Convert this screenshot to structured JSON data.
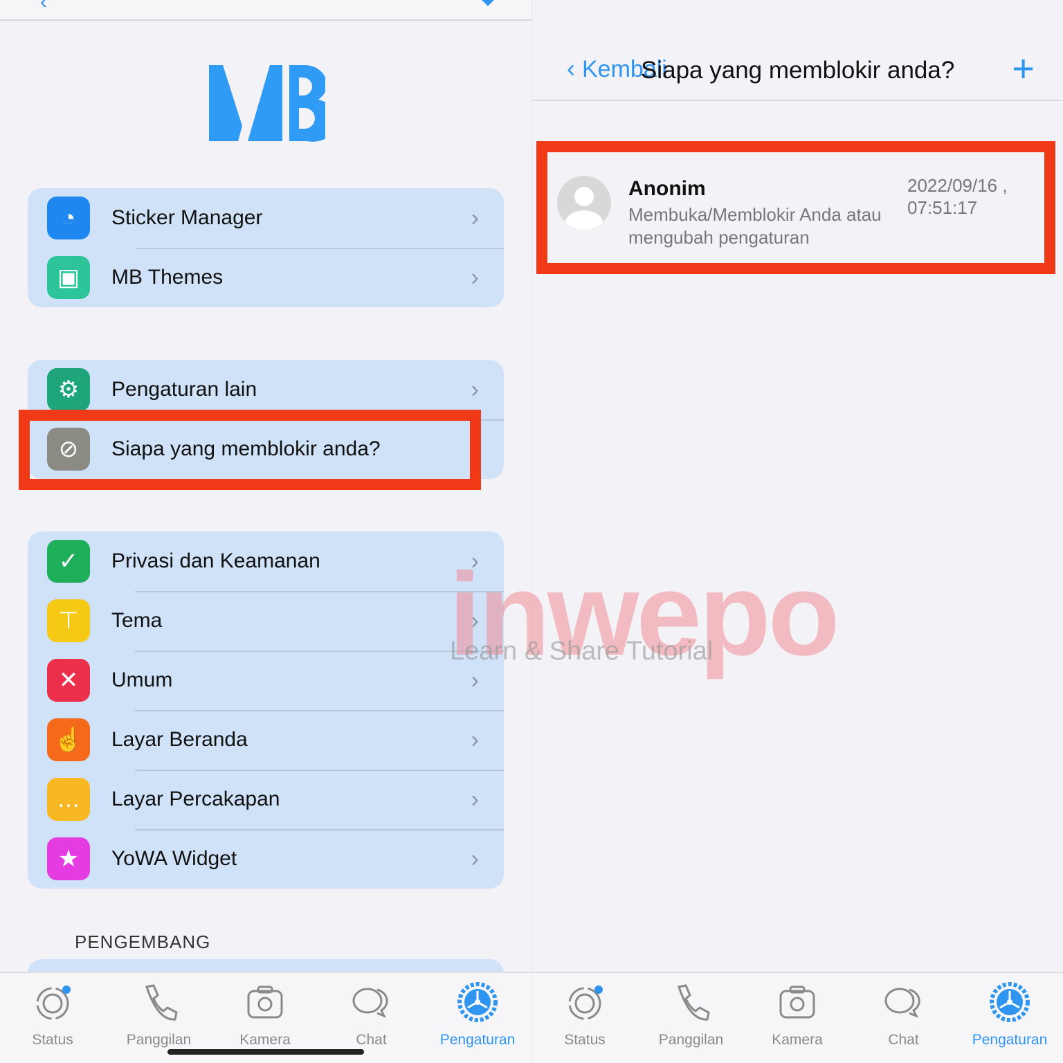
{
  "left": {
    "logo_text": "MB",
    "groups": [
      [
        {
          "label": "Sticker Manager",
          "icon": "sticker-icon",
          "color": "#1e88f0"
        },
        {
          "label": "MB Themes",
          "icon": "themes-box-icon",
          "color": "#2dc49a"
        }
      ],
      [
        {
          "label": "Pengaturan lain",
          "icon": "gear-icon",
          "color": "#1fa57a"
        },
        {
          "label": "Siapa yang memblokir anda?",
          "icon": "block-icon",
          "color": "#8b8b83"
        }
      ],
      [
        {
          "label": "Privasi dan Keamanan",
          "icon": "shield-check-icon",
          "color": "#1fae5a"
        },
        {
          "label": "Tema",
          "icon": "paint-roller-icon",
          "color": "#f6c915"
        },
        {
          "label": "Umum",
          "icon": "tools-icon",
          "color": "#ec2f4a"
        },
        {
          "label": "Layar Beranda",
          "icon": "hand-pointer-icon",
          "color": "#f56a1a"
        },
        {
          "label": "Layar Percakapan",
          "icon": "chat-bubble-icon",
          "color": "#f7b824"
        },
        {
          "label": "YoWA Widget",
          "icon": "star-icon",
          "color": "#e43ce0"
        }
      ]
    ],
    "section_label": "PENGEMBANG"
  },
  "tabs": [
    {
      "label": "Status",
      "icon": "status-icon"
    },
    {
      "label": "Panggilan",
      "icon": "phone-icon"
    },
    {
      "label": "Kamera",
      "icon": "camera-icon"
    },
    {
      "label": "Chat",
      "icon": "chat-icon"
    },
    {
      "label": "Pengaturan",
      "icon": "settings-icon",
      "active": true
    }
  ],
  "right": {
    "back_label": "Kembali",
    "title": "Siapa yang memblokir anda?",
    "entry": {
      "name": "Anonim",
      "description": "Membuka/Memblokir Anda atau mengubah pengaturan",
      "date": "2022/09/16 ,",
      "time": "07:51:17"
    }
  },
  "watermark": {
    "brand": "inwepo",
    "tagline": "Learn & Share Tutorial"
  },
  "colors": {
    "accent": "#2f95f0",
    "highlight": "#f03a17",
    "card": "#cfe2f8"
  }
}
